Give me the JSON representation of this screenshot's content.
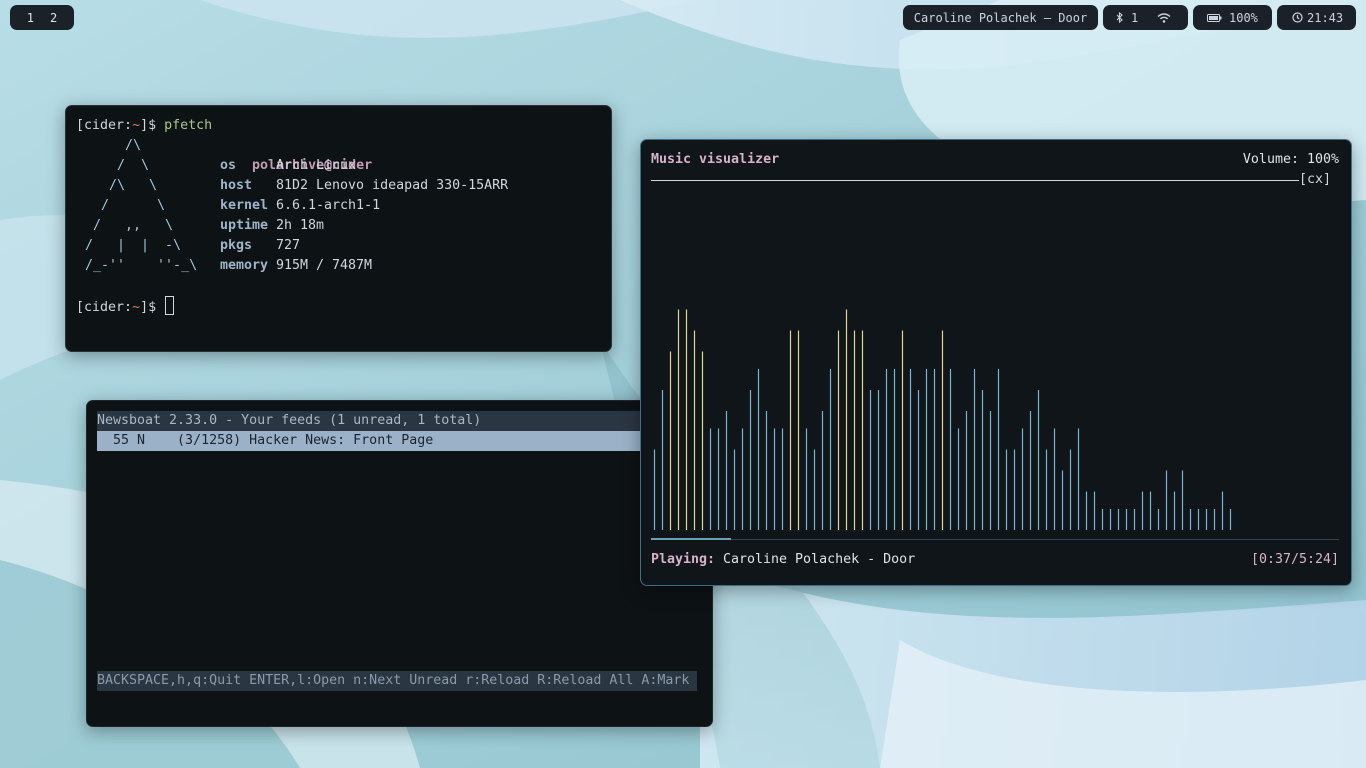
{
  "topbar": {
    "workspaces": [
      "1",
      "2"
    ],
    "media": "Caroline Polachek — Door",
    "bluetooth_count": "1",
    "battery": "100%",
    "clock": "21:43",
    "icons": {
      "bluetooth": "bluetooth-icon",
      "wifi": "wifi-icon",
      "battery": "battery-icon",
      "clock": "clock-icon"
    }
  },
  "terminal": {
    "prompt_user": "cider",
    "prompt_dir": "~",
    "command": "pfetch",
    "logo_lines": [
      "     /\\",
      "    /  \\",
      "   /\\   \\",
      "  /      \\",
      " /   ,,   \\",
      "/   |  |  -\\",
      "/_-''    ''-_\\"
    ],
    "title": "polarhive@cider",
    "info": [
      {
        "key": "os",
        "value": "Arch Linux"
      },
      {
        "key": "host",
        "value": "81D2 Lenovo ideapad 330-15ARR"
      },
      {
        "key": "kernel",
        "value": "6.6.1-arch1-1"
      },
      {
        "key": "uptime",
        "value": "2h 18m"
      },
      {
        "key": "pkgs",
        "value": "727"
      },
      {
        "key": "memory",
        "value": "915M / 7487M"
      }
    ]
  },
  "newsboat": {
    "header": "Newsboat 2.33.0 - Your feeds (1 unread, 1 total)",
    "feed_row": "  55 N    (3/1258) Hacker News: Front Page",
    "footer": "BACKSPACE,h,q:Quit ENTER,l:Open n:Next Unread r:Reload R:Reload All A:Mark"
  },
  "visualizer": {
    "title": "Music visualizer",
    "volume": "Volume: 100%",
    "close_label": "[cx]",
    "playing_label": "Playing:",
    "track": "Caroline Polachek - Door",
    "time": "[0:37/5:24]",
    "progress": 0.117,
    "bar_heights": [
      0.23,
      0.4,
      0.51,
      0.63,
      0.63,
      0.57,
      0.51,
      0.29,
      0.29,
      0.34,
      0.23,
      0.29,
      0.4,
      0.46,
      0.34,
      0.29,
      0.29,
      0.57,
      0.57,
      0.29,
      0.23,
      0.34,
      0.46,
      0.57,
      0.63,
      0.57,
      0.57,
      0.4,
      0.4,
      0.46,
      0.46,
      0.57,
      0.46,
      0.4,
      0.46,
      0.46,
      0.57,
      0.46,
      0.29,
      0.34,
      0.46,
      0.4,
      0.34,
      0.46,
      0.23,
      0.23,
      0.29,
      0.34,
      0.4,
      0.23,
      0.29,
      0.17,
      0.23,
      0.29,
      0.11,
      0.11,
      0.06,
      0.06,
      0.06,
      0.06,
      0.06,
      0.11,
      0.11,
      0.06,
      0.17,
      0.11,
      0.17,
      0.06,
      0.06,
      0.06,
      0.06,
      0.11,
      0.06,
      0,
      0,
      0,
      0,
      0,
      0,
      0,
      0,
      0,
      0,
      0,
      0,
      0,
      0,
      0,
      0,
      0,
      0,
      0,
      0,
      0,
      0,
      0,
      0,
      0,
      0,
      0,
      0,
      0,
      0,
      0,
      0,
      0,
      0,
      0,
      0,
      0,
      0,
      0,
      0,
      0,
      0,
      0,
      0,
      0,
      0,
      0.06,
      0.11,
      0.11
    ],
    "bar_colors": {
      "low": "#7ab6cf",
      "high": "#e6d69a"
    }
  },
  "theme": {
    "wallpaper_base": "#a9d4dd",
    "wallpaper_light": "#cfe6f1",
    "wallpaper_dark": "#5f9aa6"
  }
}
